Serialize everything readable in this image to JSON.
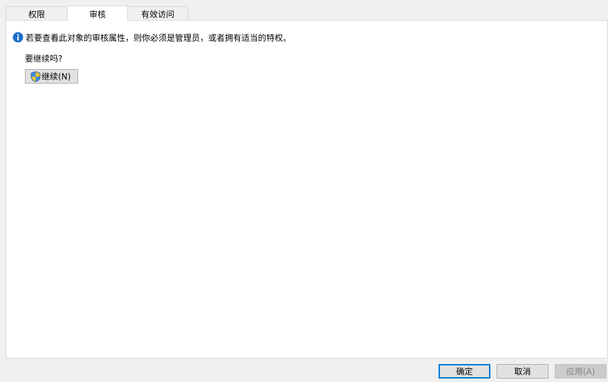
{
  "tabs": [
    {
      "label": "权限",
      "active": false
    },
    {
      "label": "审核",
      "active": true
    },
    {
      "label": "有效访问",
      "active": false
    }
  ],
  "panel": {
    "info_icon": "info-icon",
    "info_message": "若要查看此对象的审核属性，则你必须是管理员，或者拥有适当的特权。",
    "question": "要继续吗?",
    "continue_button": {
      "icon": "uac-shield-icon",
      "label": "继续(N)"
    }
  },
  "footer": {
    "ok_label": "确定",
    "cancel_label": "取消",
    "apply_label": "应用(A)",
    "apply_enabled": false
  },
  "colors": {
    "accent": "#0078d7",
    "window_bg": "#f0f0f0",
    "panel_bg": "#ffffff",
    "button_bg": "#e1e1e1",
    "disabled_text": "#838383"
  }
}
